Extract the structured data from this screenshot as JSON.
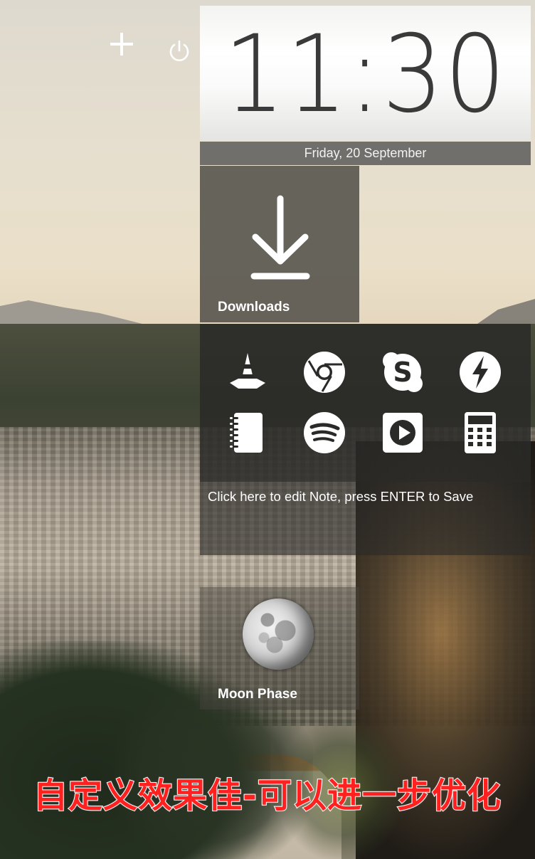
{
  "clock": {
    "time": "11:30",
    "date": "Friday, 20 September"
  },
  "tiles": {
    "downloads": {
      "label": "Downloads",
      "icon": "download-icon"
    },
    "note": {
      "placeholder": "Click here to edit Note, press ENTER to Save"
    },
    "moon": {
      "label": "Moon Phase",
      "icon": "moon-icon"
    }
  },
  "apps": [
    {
      "name": "vlc",
      "icon": "vlc-cone-icon"
    },
    {
      "name": "chrome",
      "icon": "chrome-icon"
    },
    {
      "name": "skype",
      "icon": "skype-icon"
    },
    {
      "name": "flash",
      "icon": "lightning-icon"
    },
    {
      "name": "notebook",
      "icon": "notebook-icon"
    },
    {
      "name": "spotify",
      "icon": "spotify-icon"
    },
    {
      "name": "media-player",
      "icon": "play-icon"
    },
    {
      "name": "calculator",
      "icon": "calculator-icon"
    }
  ],
  "controls": {
    "add_icon": "plus-icon",
    "power_icon": "power-icon"
  },
  "caption": "自定义效果佳-可以进一步优化",
  "colors": {
    "caption": "#ff2020",
    "tile_dark": "#2a2a28",
    "clock_text": "#3a3a3a"
  }
}
